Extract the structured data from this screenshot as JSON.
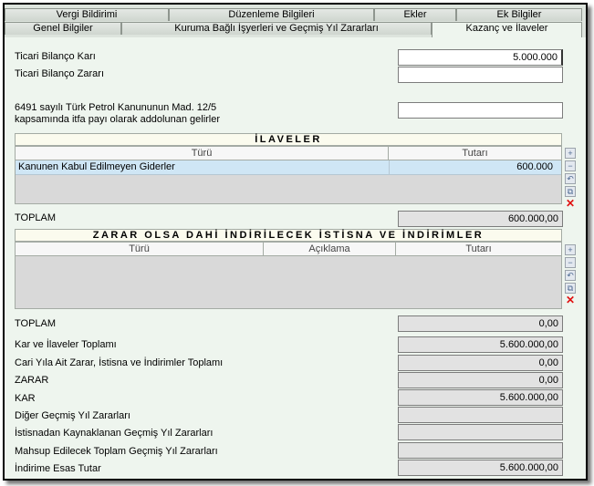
{
  "tabs_row1": [
    "Vergi Bildirimi",
    "Düzenleme Bilgileri",
    "Ekler",
    "Ek Bilgiler"
  ],
  "tabs_row2": [
    "Genel Bilgiler",
    "Kuruma Bağlı İşyerleri ve Geçmiş Yıl Zararları",
    "Kazanç ve İlaveler"
  ],
  "form": {
    "ticari_bilanco_kari_label": "Ticari Bilanço Karı",
    "ticari_bilanco_kari_value": "5.000.000",
    "ticari_bilanco_zarari_label": "Ticari Bilanço Zararı",
    "ticari_bilanco_zarari_value": "",
    "petrol_label_1": "6491 sayılı Türk Petrol Kanununun Mad. 12/5",
    "petrol_label_2": "kapsamında itfa payı olarak addolunan gelirler",
    "petrol_value": ""
  },
  "ilaveler": {
    "title": "İLAVELER",
    "columns": [
      "Türü",
      "Tutarı"
    ],
    "rows": [
      {
        "turu": "Kanunen Kabul Edilmeyen Giderler",
        "tutari": "600.000"
      }
    ],
    "toplam_label": "TOPLAM",
    "toplam_value": "600.000,00"
  },
  "zarar": {
    "title": "ZARAR OLSA DAHİ İNDİRİLECEK İSTİSNA VE İNDİRİMLER",
    "columns": [
      "Türü",
      "Açıklama",
      "Tutarı"
    ],
    "toplam_label": "TOPLAM",
    "toplam_value": "0,00"
  },
  "summary": [
    {
      "label": "Kar ve İlaveler Toplamı",
      "value": "5.600.000,00"
    },
    {
      "label": "Cari Yıla Ait Zarar, İstisna ve İndirimler Toplamı",
      "value": "0,00"
    },
    {
      "label": "ZARAR",
      "value": "0,00"
    },
    {
      "label": "KAR",
      "value": "5.600.000,00"
    },
    {
      "label": "Diğer Geçmiş Yıl Zararları",
      "value": ""
    },
    {
      "label": "İstisnadan Kaynaklanan Geçmiş Yıl Zararları",
      "value": ""
    },
    {
      "label": "Mahsup Edilecek Toplam Geçmiş Yıl Zararları",
      "value": ""
    },
    {
      "label": "İndirime Esas Tutar",
      "value": "5.600.000,00"
    }
  ],
  "side_buttons": [
    "add-icon",
    "remove-icon",
    "undo-icon",
    "copy-icon",
    "delete-icon"
  ],
  "colors": {
    "panel_bg": "#eef5ee",
    "row_highlight": "#cfe6f5",
    "delete_red": "#e01010"
  }
}
